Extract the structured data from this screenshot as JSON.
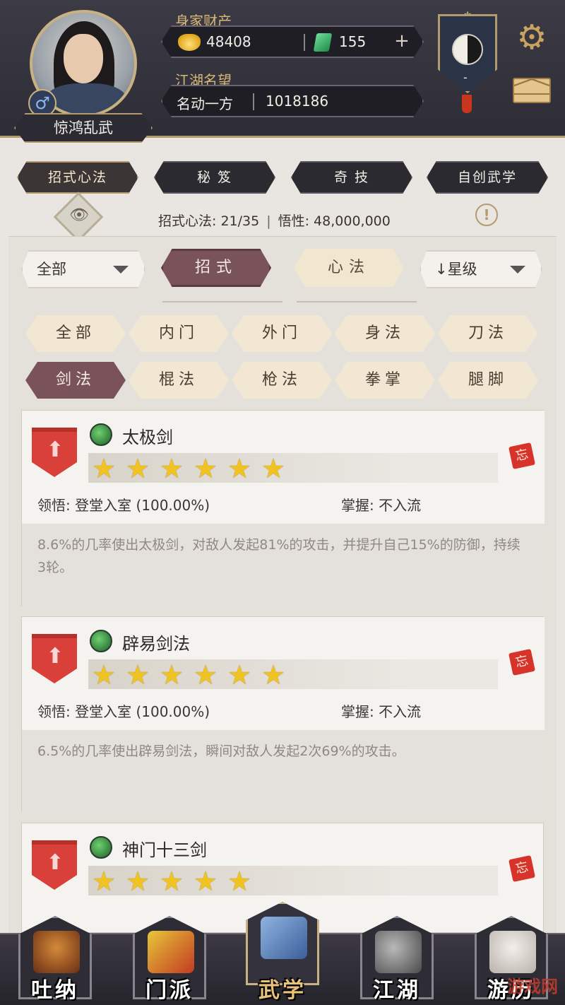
{
  "player": {
    "name": "惊鸿乱武",
    "gender_symbol": "♂"
  },
  "wealth": {
    "label": "身家财产",
    "gold": "48408",
    "jade": "155",
    "add_symbol": "+"
  },
  "fame": {
    "label": "江湖名望",
    "rank": "名动一方",
    "value": "1018186"
  },
  "banner": {
    "value": "-"
  },
  "main_tabs": [
    {
      "label": "招式心法",
      "active": true
    },
    {
      "label": "秘 笈",
      "active": false
    },
    {
      "label": "奇 技",
      "active": false
    },
    {
      "label": "自创武学",
      "active": false
    }
  ],
  "stats": {
    "moves_label": "招式心法: 21/35",
    "insight_label": "悟性: 48,000,000",
    "separator": "|"
  },
  "filters": {
    "category_dropdown": "全部",
    "sort_dropdown": "星级",
    "sort_icon": "↓",
    "type_tabs": [
      {
        "label": "招式",
        "active": true
      },
      {
        "label": "心法",
        "active": false
      }
    ],
    "chips": [
      {
        "label": "全部",
        "active": false
      },
      {
        "label": "内门",
        "active": false
      },
      {
        "label": "外门",
        "active": false
      },
      {
        "label": "身法",
        "active": false
      },
      {
        "label": "刀法",
        "active": false
      },
      {
        "label": "剑法",
        "active": true
      },
      {
        "label": "棍法",
        "active": false
      },
      {
        "label": "枪法",
        "active": false
      },
      {
        "label": "拳掌",
        "active": false
      },
      {
        "label": "腿脚",
        "active": false
      }
    ]
  },
  "skills": [
    {
      "name": "太极剑",
      "stars": 6,
      "comprehension": "领悟: 登堂入室 (100.00%)",
      "mastery": "掌握: 不入流",
      "forget_tag": "忘",
      "description": "8.6%的几率使出太极剑，对敌人发起81%的攻击，并提升自己15%的防御，持续3轮。"
    },
    {
      "name": "辟易剑法",
      "stars": 6,
      "comprehension": "领悟: 登堂入室 (100.00%)",
      "mastery": "掌握: 不入流",
      "forget_tag": "忘",
      "description": "6.5%的几率使出辟易剑法，瞬间对敌人发起2次69%的攻击。"
    },
    {
      "name": "神门十三剑",
      "stars": 5,
      "forget_tag": "忘"
    }
  ],
  "bottom_nav": [
    {
      "label": "吐纳",
      "active": false
    },
    {
      "label": "门派",
      "active": false
    },
    {
      "label": "武学",
      "active": true
    },
    {
      "label": "江湖",
      "active": false
    },
    {
      "label": "游历",
      "active": false
    }
  ],
  "watermark": "游戏网",
  "colors": {
    "accent_gold": "#c9b181",
    "active_tab": "#7a5259",
    "star": "#f0c322",
    "shield_red": "#d9403a"
  }
}
